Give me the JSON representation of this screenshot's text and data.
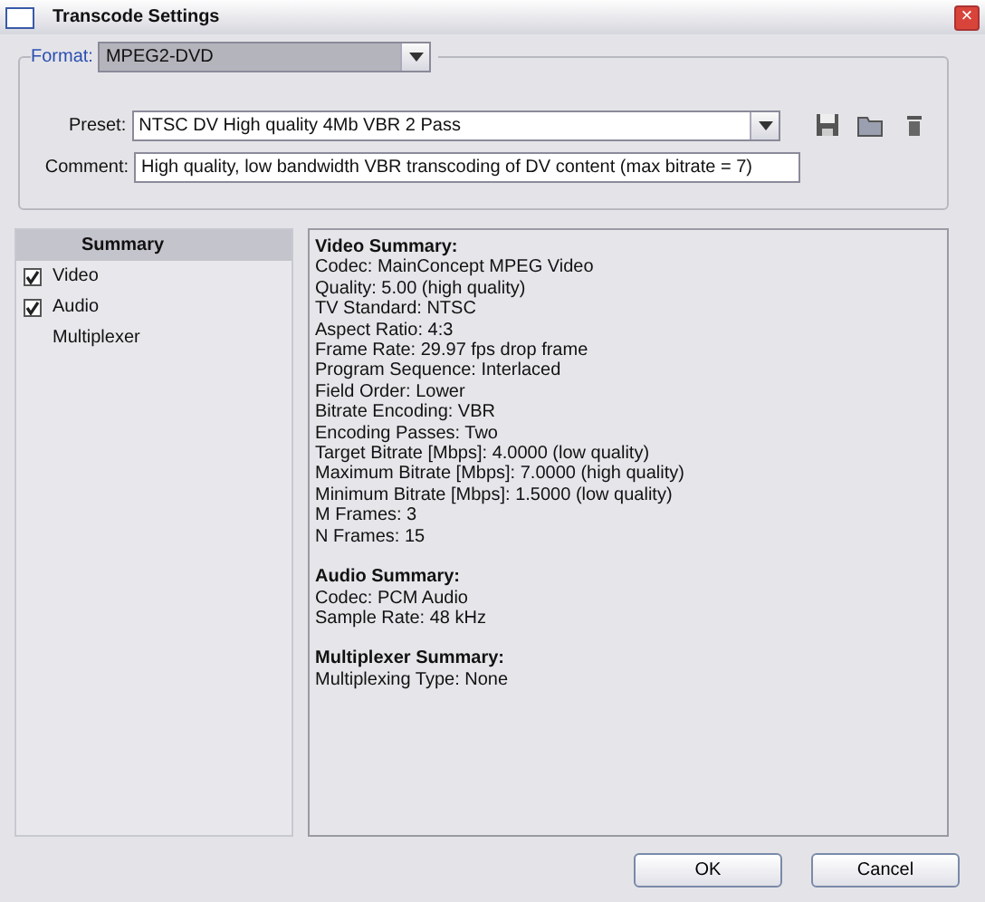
{
  "window": {
    "title": "Transcode Settings",
    "close": "×"
  },
  "format": {
    "label": "Format:",
    "value": "MPEG2-DVD"
  },
  "preset": {
    "label": "Preset:",
    "value": "NTSC DV High quality 4Mb VBR 2 Pass"
  },
  "comment": {
    "label": "Comment:",
    "value": "High quality, low bandwidth VBR transcoding of DV content (max bitrate = 7)"
  },
  "sidebar": {
    "items": [
      {
        "label": "Summary",
        "kind": "header",
        "selected": true
      },
      {
        "label": "Video",
        "kind": "check",
        "checked": true,
        "selected": false
      },
      {
        "label": "Audio",
        "kind": "check",
        "checked": true,
        "selected": false
      },
      {
        "label": "Multiplexer",
        "kind": "plain",
        "selected": false
      }
    ]
  },
  "summary": [
    {
      "heading": "Video Summary:",
      "lines": [
        "Codec: MainConcept MPEG Video",
        "Quality: 5.00 (high quality)",
        "TV Standard: NTSC",
        "Aspect Ratio: 4:3",
        "Frame Rate: 29.97 fps drop frame",
        "Program Sequence: Interlaced",
        "Field Order: Lower",
        "Bitrate Encoding: VBR",
        "Encoding Passes: Two",
        "Target Bitrate [Mbps]: 4.0000 (low quality)",
        "Maximum Bitrate [Mbps]: 7.0000 (high quality)",
        "Minimum Bitrate [Mbps]: 1.5000 (low quality)",
        "M Frames: 3",
        "N Frames: 15"
      ]
    },
    {
      "heading": "Audio Summary:",
      "lines": [
        "Codec: PCM Audio",
        "Sample Rate: 48 kHz"
      ]
    },
    {
      "heading": "Multiplexer Summary:",
      "lines": [
        "Multiplexing Type: None"
      ]
    }
  ],
  "buttons": [
    "OK",
    "Cancel"
  ]
}
